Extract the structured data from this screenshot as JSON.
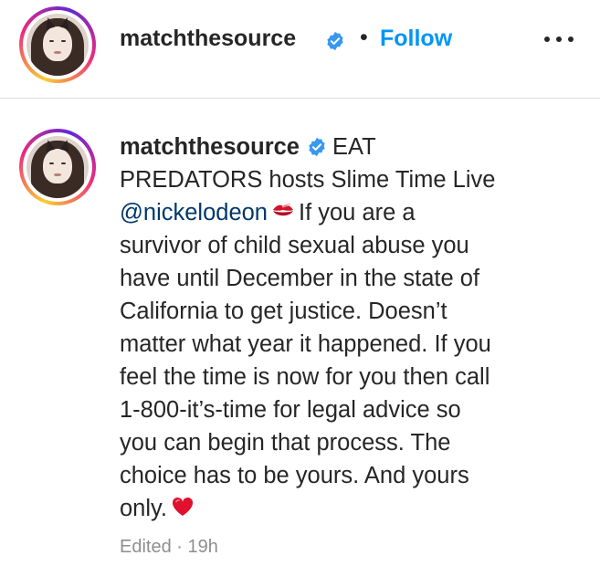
{
  "header": {
    "username": "matchthesource",
    "separator": "•",
    "follow_label": "Follow",
    "more_label": "More options"
  },
  "comment": {
    "username": "matchthesource",
    "lines": [
      "EAT",
      "PREDATORS hosts Slime Time Live",
      "@nickelodeon",
      "If you are a",
      "survivor of child sexual abuse you",
      "have until December in the state of",
      "California to get justice. Doesn’t",
      "matter what year it happened. If you",
      "feel the time is now for you then call",
      "1-800-it’s-time for legal advice so",
      "you can begin that process. The",
      "choice has to be yours. And yours",
      "only."
    ],
    "edited_label": "Edited",
    "meta_separator": "·",
    "time": "19h"
  },
  "colors": {
    "follow": "#0095f6",
    "mention": "#00376b",
    "verified": "#3897f0",
    "meta": "#8e8e8e"
  },
  "icons": [
    "verified-badge-icon",
    "kiss-mark-icon",
    "red-heart-icon",
    "more-options-icon"
  ]
}
